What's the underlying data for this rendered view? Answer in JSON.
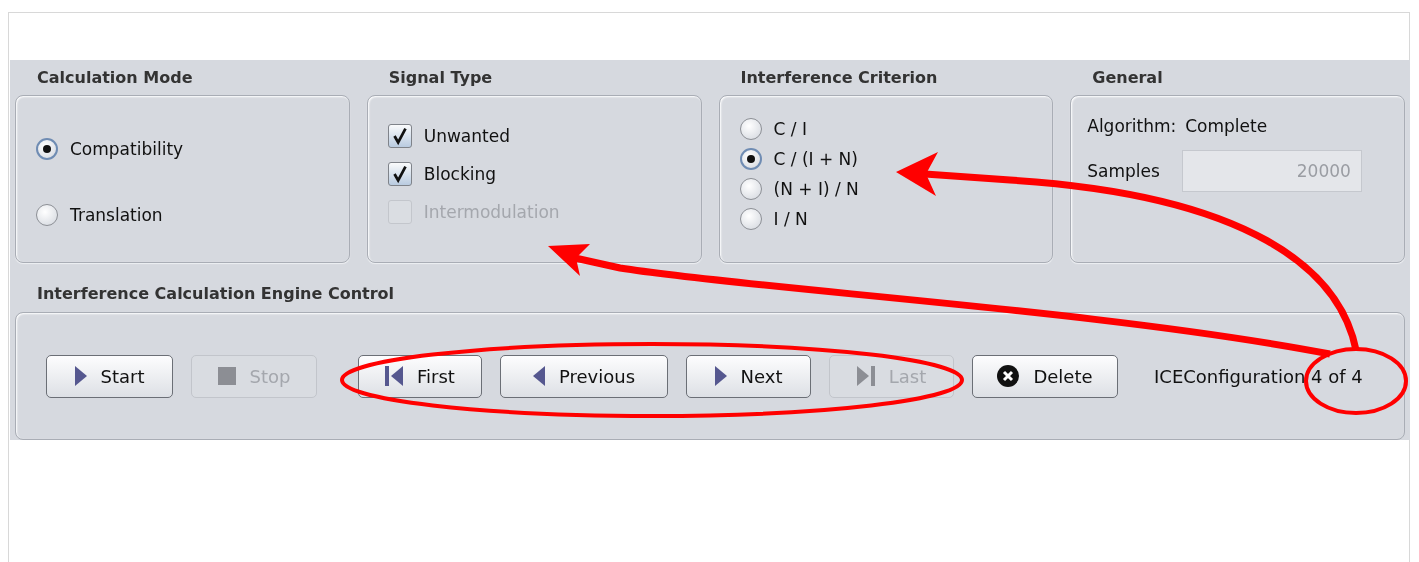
{
  "calculation_mode": {
    "title": "Calculation Mode",
    "options": [
      {
        "label": "Compatibility",
        "selected": true
      },
      {
        "label": "Translation",
        "selected": false
      }
    ]
  },
  "signal_type": {
    "title": "Signal Type",
    "options": [
      {
        "label": "Unwanted",
        "checked": true,
        "disabled": false
      },
      {
        "label": "Blocking",
        "checked": true,
        "disabled": false
      },
      {
        "label": "Intermodulation",
        "checked": false,
        "disabled": true
      }
    ]
  },
  "interference_criterion": {
    "title": "Interference Criterion",
    "options": [
      {
        "label": "C / I",
        "selected": false
      },
      {
        "label": "C / (I + N)",
        "selected": true
      },
      {
        "label": "(N + I) / N",
        "selected": false
      },
      {
        "label": "I / N",
        "selected": false
      }
    ]
  },
  "general": {
    "title": "General",
    "algorithm_label": "Algorithm:",
    "algorithm_value": "Complete",
    "samples_label": "Samples",
    "samples_value": "20000",
    "samples_disabled": true
  },
  "engine_control": {
    "title": "Interference Calculation Engine Control",
    "buttons": [
      {
        "label": "Start",
        "kind": "play",
        "disabled": false
      },
      {
        "label": "Stop",
        "kind": "stop",
        "disabled": true
      },
      {
        "label": "First",
        "kind": "first",
        "disabled": false
      },
      {
        "label": "Previous",
        "kind": "previous",
        "disabled": false
      },
      {
        "label": "Next",
        "kind": "next",
        "disabled": false
      },
      {
        "label": "Last",
        "kind": "last",
        "disabled": true
      },
      {
        "label": "Delete",
        "kind": "delete",
        "disabled": false
      }
    ],
    "status": "ICEConfiguration 4 of 4"
  }
}
